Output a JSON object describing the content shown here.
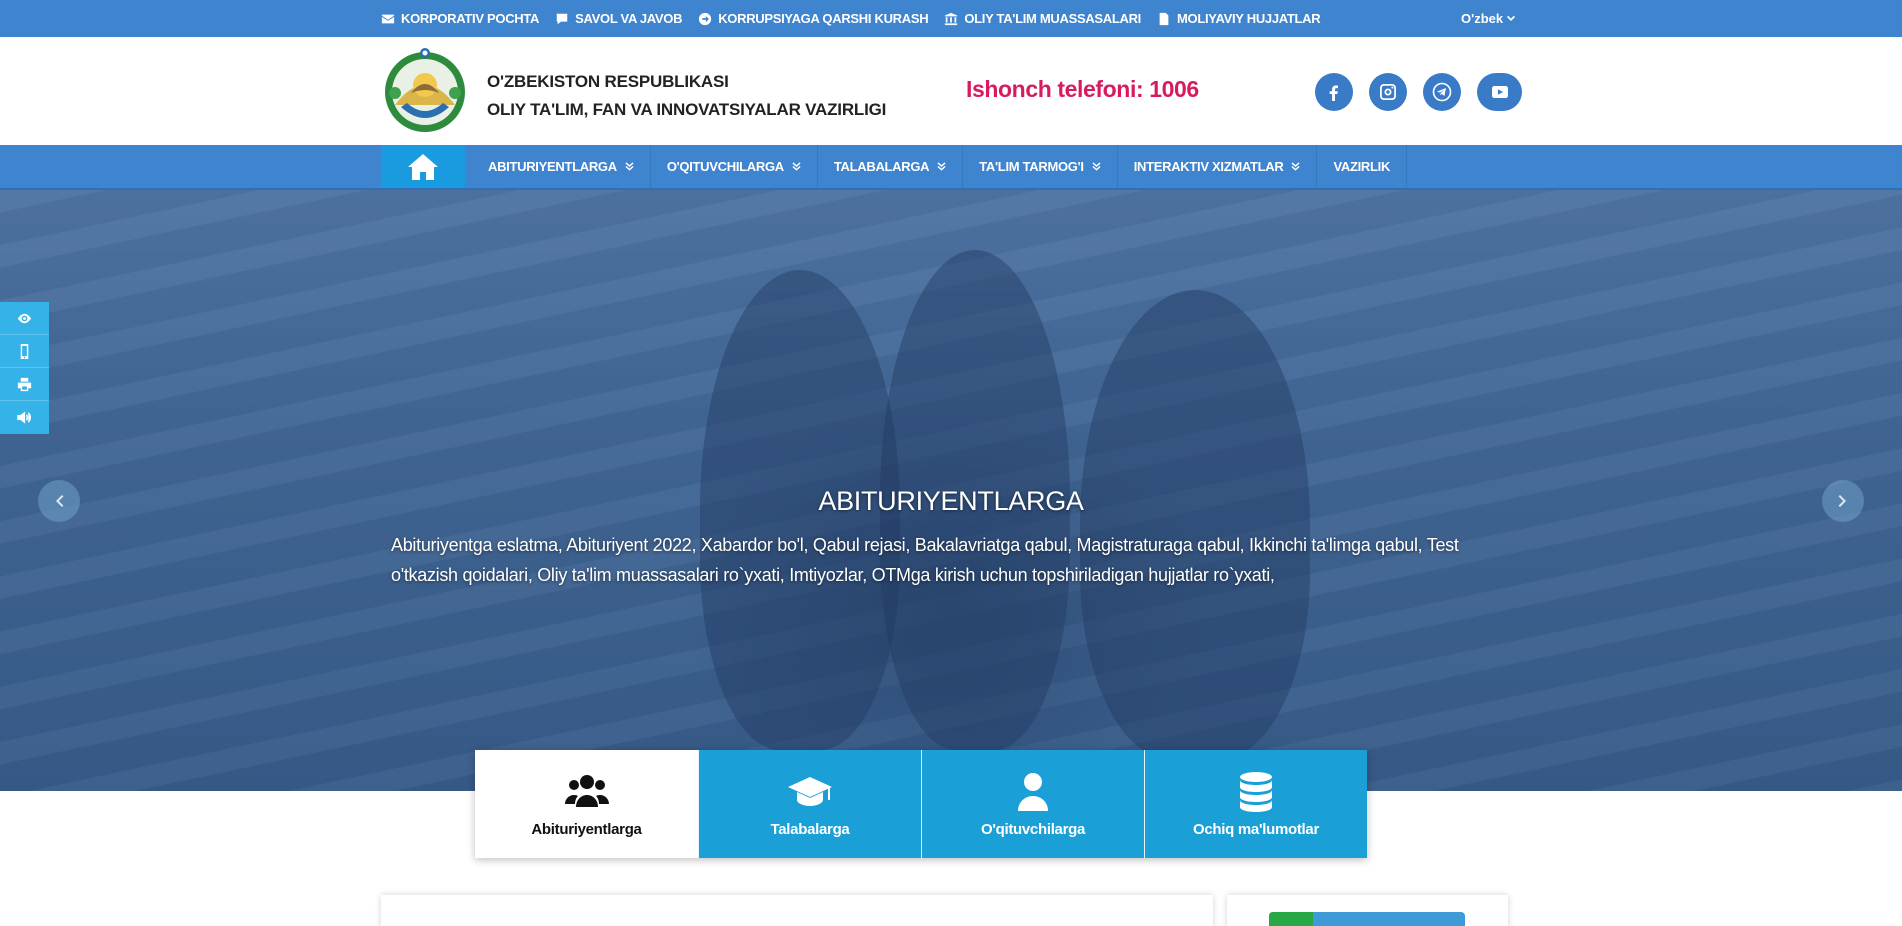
{
  "topbar": {
    "links": [
      {
        "label": "KORPORATIV POCHTA",
        "icon": "envelope-icon"
      },
      {
        "label": "SAVOL VA JAVOB",
        "icon": "comment-icon"
      },
      {
        "label": "KORRUPSIYAGA QARSHI KURASH",
        "icon": "arrow-circle-icon"
      },
      {
        "label": "OLIY TA'LIM MUASSASALARI",
        "icon": "university-icon"
      },
      {
        "label": "MOLIYAVIY HUJJATLAR",
        "icon": "document-icon"
      }
    ],
    "language": "O'zbek"
  },
  "header": {
    "org_line1": "O'ZBEKISTON RESPUBLIKASI",
    "org_line2": "OLIY TA'LIM, FAN VA INNOVATSIYALAR VAZIRLIGI",
    "hotline": "Ishonch telefoni: 1006",
    "hotline_color": "#d81b60",
    "socials": [
      "facebook-icon",
      "instagram-icon",
      "telegram-icon",
      "youtube-icon"
    ]
  },
  "nav": {
    "items": [
      {
        "label": "ABITURIYENTLARGA",
        "dropdown": true
      },
      {
        "label": "O'QITUVCHILARGA",
        "dropdown": true
      },
      {
        "label": "TALABALARGA",
        "dropdown": true
      },
      {
        "label": "TA'LIM TARMOG'I",
        "dropdown": true
      },
      {
        "label": "INTERAKTIV XIZMATLAR",
        "dropdown": true
      },
      {
        "label": "VAZIRLIK",
        "dropdown": false
      }
    ]
  },
  "hero": {
    "title": "ABITURIYENTLARGA",
    "text": "Abituriyentga eslatma, Abituriyent 2022, Xabardor bo'l, Qabul rejasi, Bakalavriatga qabul, Magistraturaga qabul, Ikkinchi ta'limga qabul, Test o'tkazish qoidalari, Oliy ta'lim muassasalari ro`yxati, Imtiyozlar, OTMga kirish uchun topshiriladigan hujjatlar ro`yxati,"
  },
  "cards": [
    {
      "label": "Abituriyentlarga",
      "icon": "users-icon",
      "active": true
    },
    {
      "label": "Talabalarga",
      "icon": "graduation-cap-icon",
      "active": false
    },
    {
      "label": "O'qituvchilarga",
      "icon": "user-icon",
      "active": false
    },
    {
      "label": "Ochiq ma'lumotlar",
      "icon": "database-icon",
      "active": false
    }
  ],
  "colors": {
    "primary": "#3f84cf",
    "accent": "#1a9fd6",
    "toolbar": "#35b3e8"
  }
}
